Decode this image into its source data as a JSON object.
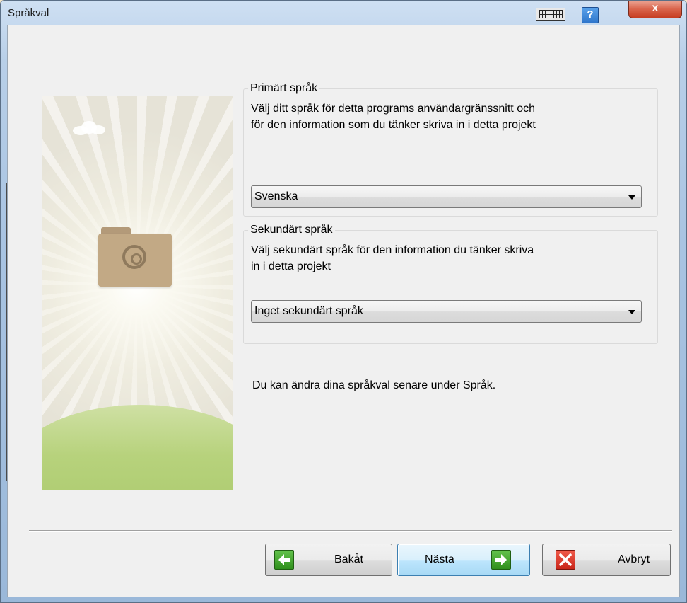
{
  "window": {
    "title": "Språkval"
  },
  "titlebar": {
    "keyboard_icon": "keyboard-icon",
    "help_label": "?",
    "close_label": "x"
  },
  "primary": {
    "legend": "Primärt språk",
    "description_line1": "Välj ditt språk för detta programs användargränssnitt och",
    "description_line2": "för den information som du tänker skriva in i detta projekt",
    "selected": "Svenska"
  },
  "secondary": {
    "legend": "Sekundärt språk",
    "description_line1": "Välj sekundärt språk för den information du tänker skriva",
    "description_line2": "in i detta projekt",
    "selected": "Inget sekundärt språk"
  },
  "note": "Du kan ändra dina språkval senare under Språk.",
  "buttons": {
    "back": "Bakåt",
    "next": "Nästa",
    "cancel": "Avbryt"
  },
  "colors": {
    "back_icon": "#3aa12a",
    "next_icon": "#3aa12a",
    "cancel_icon": "#d8362a",
    "focus_button": "#bee6fd"
  }
}
